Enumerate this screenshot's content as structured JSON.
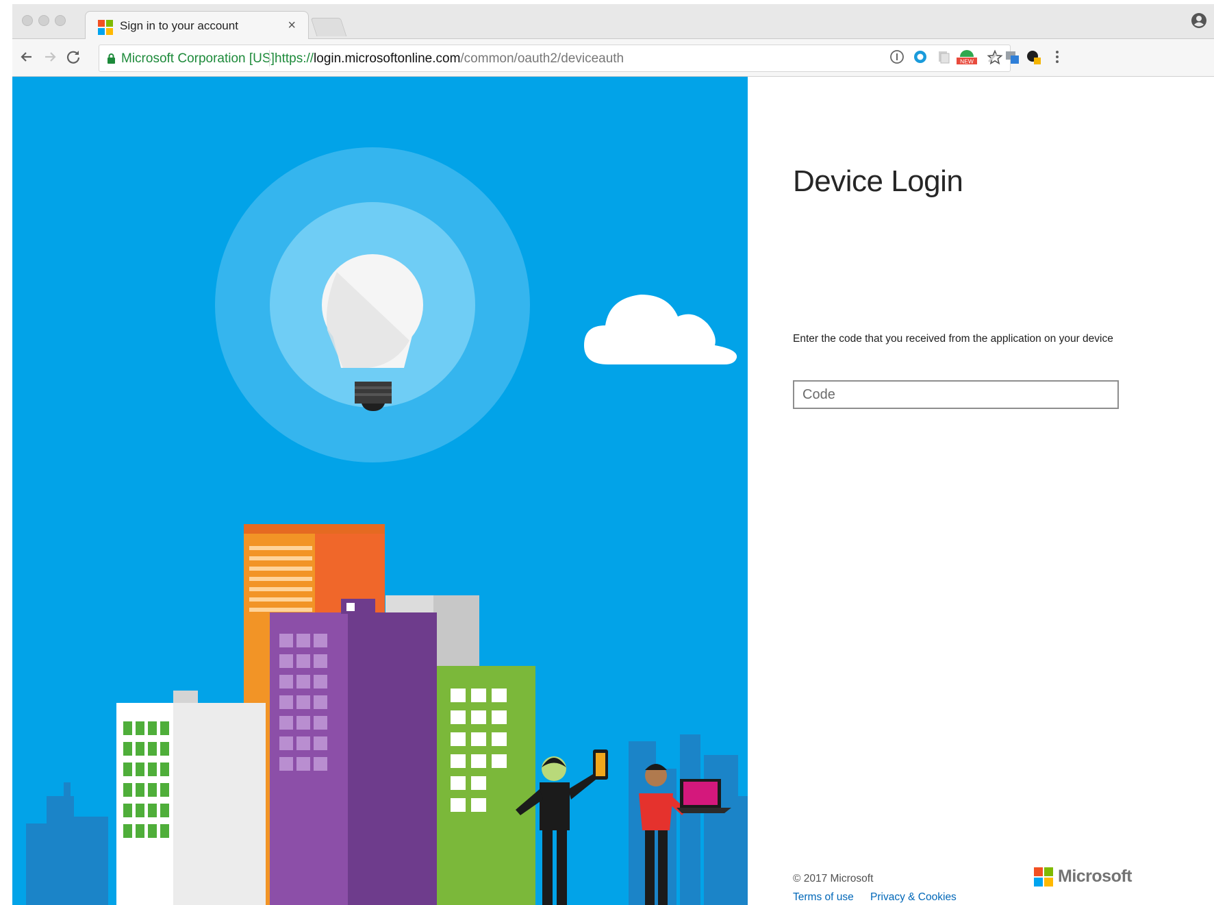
{
  "browser": {
    "tab_title": "Sign in to your account",
    "tab_close_glyph": "×",
    "ev_org": "Microsoft Corporation [US]",
    "url_scheme": "https://",
    "url_host": "login.microsoftonline.com",
    "url_path": "/common/oauth2/deviceauth",
    "extension_badge": "NEW"
  },
  "page": {
    "heading": "Device Login",
    "instructions": "Enter the code that you received from the application on your device",
    "code_placeholder": "Code",
    "code_value": ""
  },
  "footer": {
    "copyright": "© 2017 Microsoft",
    "terms": "Terms of use",
    "privacy": "Privacy & Cookies",
    "brand": "Microsoft"
  },
  "colors": {
    "background_blue": "#02a3e8",
    "link": "#0067b8",
    "ms_red": "#f25022",
    "ms_green": "#7fba00",
    "ms_blue": "#00a4ef",
    "ms_yellow": "#ffb900"
  }
}
